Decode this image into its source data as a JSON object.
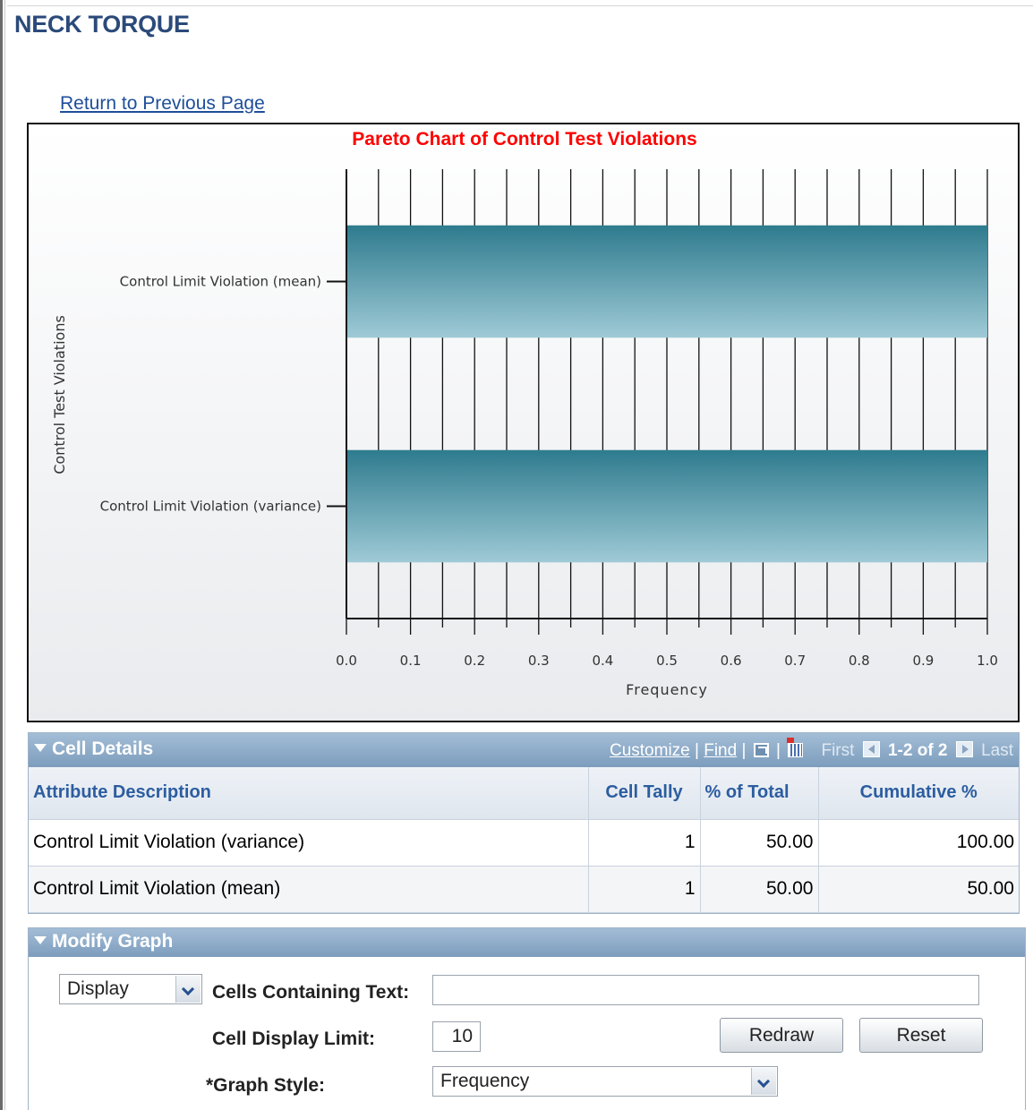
{
  "page": {
    "title": "NECK TORQUE",
    "return_link": "Return to Previous Page"
  },
  "chart_data": {
    "type": "bar",
    "orientation": "horizontal",
    "title": "Pareto Chart of Control Test Violations",
    "xlabel": "Frequency",
    "ylabel": "Control Test Violations",
    "categories": [
      "Control Limit Violation (mean)",
      "Control Limit Violation (variance)"
    ],
    "values": [
      1.0,
      1.0
    ],
    "xlim": [
      0.0,
      1.0
    ],
    "x_ticks": [
      "0.0",
      "0.1",
      "0.2",
      "0.3",
      "0.4",
      "0.5",
      "0.6",
      "0.7",
      "0.8",
      "0.9",
      "1.0"
    ],
    "grid": "vertical",
    "colors": {
      "bar_top": "#2e7b8e",
      "bar_bottom": "#9fcad6",
      "title": "#ff0000"
    }
  },
  "cell_details": {
    "title": "Cell Details",
    "nav": {
      "customize": "Customize",
      "find": "Find",
      "first": "First",
      "count": "1-2 of 2",
      "last": "Last"
    },
    "columns": [
      "Attribute Description",
      "Cell Tally",
      "% of Total",
      "Cumulative %"
    ],
    "rows": [
      {
        "attribute": "Control Limit Violation (variance)",
        "tally": "1",
        "pct": "50.00",
        "cumulative": "100.00"
      },
      {
        "attribute": "Control Limit Violation (mean)",
        "tally": "1",
        "pct": "50.00",
        "cumulative": "50.00"
      }
    ]
  },
  "modify_graph": {
    "title": "Modify Graph",
    "display_select": "Display",
    "cells_text_label": "Cells Containing Text:",
    "cells_text_value": "",
    "limit_label": "Cell Display Limit:",
    "limit_value": "10",
    "redraw": "Redraw",
    "reset": "Reset",
    "style_label": "*Graph Style:",
    "style_value": "Frequency"
  }
}
